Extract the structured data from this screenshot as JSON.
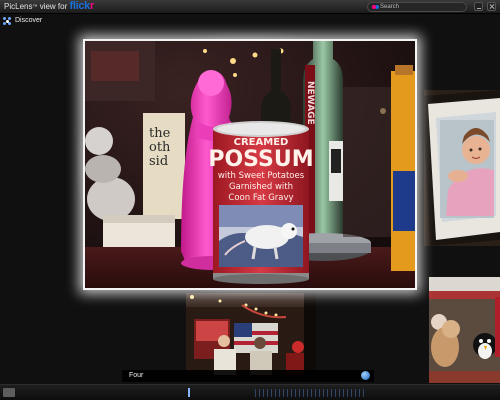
{
  "window": {
    "title_prefix": "PicLens",
    "trademark": "™",
    "title_middle": " view for ",
    "brand_main": "flick",
    "brand_accent": "r"
  },
  "search": {
    "label": "Search"
  },
  "discover": {
    "label": "Discover"
  },
  "caption": {
    "title": "Four"
  },
  "main_photo": {
    "can_lines": [
      "CREAMED",
      "POSSUM",
      "with Sweet Potatoes",
      "Garnished with",
      "Coon Fat Gravy"
    ],
    "book_lines": [
      "the",
      "oth",
      "sid"
    ],
    "bottle_text": "NEWAGE"
  },
  "colors": {
    "flickr_blue": "#1a6fd9",
    "flickr_pink": "#ff0084",
    "statue_pink": "#ff3fc4",
    "can_red": "#c8242f"
  }
}
